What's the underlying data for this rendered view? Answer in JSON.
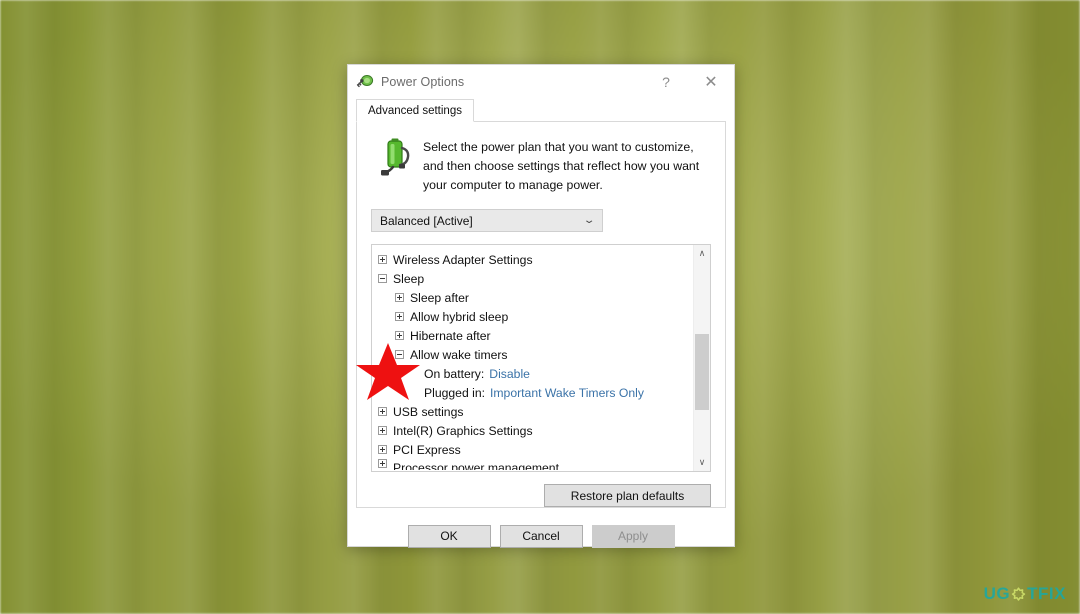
{
  "window": {
    "title": "Power Options",
    "icon": "power-plug-battery-icon",
    "help_label": "?",
    "close_label": "✕"
  },
  "tabs": [
    {
      "label": "Advanced settings",
      "active": true
    }
  ],
  "content": {
    "blurb_icon": "battery-power-cord-icon",
    "blurb": "Select the power plan that you want to customize, and then choose settings that reflect how you want your computer to manage power.",
    "plan_combo": {
      "value": "Balanced [Active]",
      "caret": "⌄"
    },
    "tree": {
      "rows": [
        {
          "indent": 0,
          "state": "plus",
          "label": "Wireless Adapter Settings"
        },
        {
          "indent": 0,
          "state": "minus",
          "label": "Sleep"
        },
        {
          "indent": 1,
          "state": "plus",
          "label": "Sleep after"
        },
        {
          "indent": 1,
          "state": "plus",
          "label": "Allow hybrid sleep"
        },
        {
          "indent": 1,
          "state": "plus",
          "label": "Hibernate after"
        },
        {
          "indent": 1,
          "state": "minus",
          "label": "Allow wake timers"
        },
        {
          "indent": 2,
          "state": "none",
          "label": "On battery:",
          "value": "Disable"
        },
        {
          "indent": 2,
          "state": "none",
          "label": "Plugged in:",
          "value": "Important Wake Timers Only"
        },
        {
          "indent": 0,
          "state": "plus",
          "label": "USB settings"
        },
        {
          "indent": 0,
          "state": "plus",
          "label": "Intel(R) Graphics Settings"
        },
        {
          "indent": 0,
          "state": "plus",
          "label": "PCI Express"
        },
        {
          "indent": 0,
          "state": "plus",
          "label": "Processor power management",
          "clipped": true
        }
      ],
      "scrollbar": {
        "up_arrow": "∧",
        "down_arrow": "∨"
      }
    },
    "restore_button": "Restore plan defaults"
  },
  "footer": {
    "ok": "OK",
    "cancel": "Cancel",
    "apply": "Apply",
    "apply_disabled": true
  },
  "annotation": {
    "shape": "red-star",
    "color": "#ee1111"
  },
  "watermark": {
    "part1": "UG",
    "glyph": "gear-icon",
    "part2": "TFIX",
    "color_teal": "#1fa8a0",
    "color_light": "#cfe06a"
  },
  "colors": {
    "link": "#3b73a8",
    "desktop": "#9fa843",
    "dialog_bg": "#ffffff"
  }
}
